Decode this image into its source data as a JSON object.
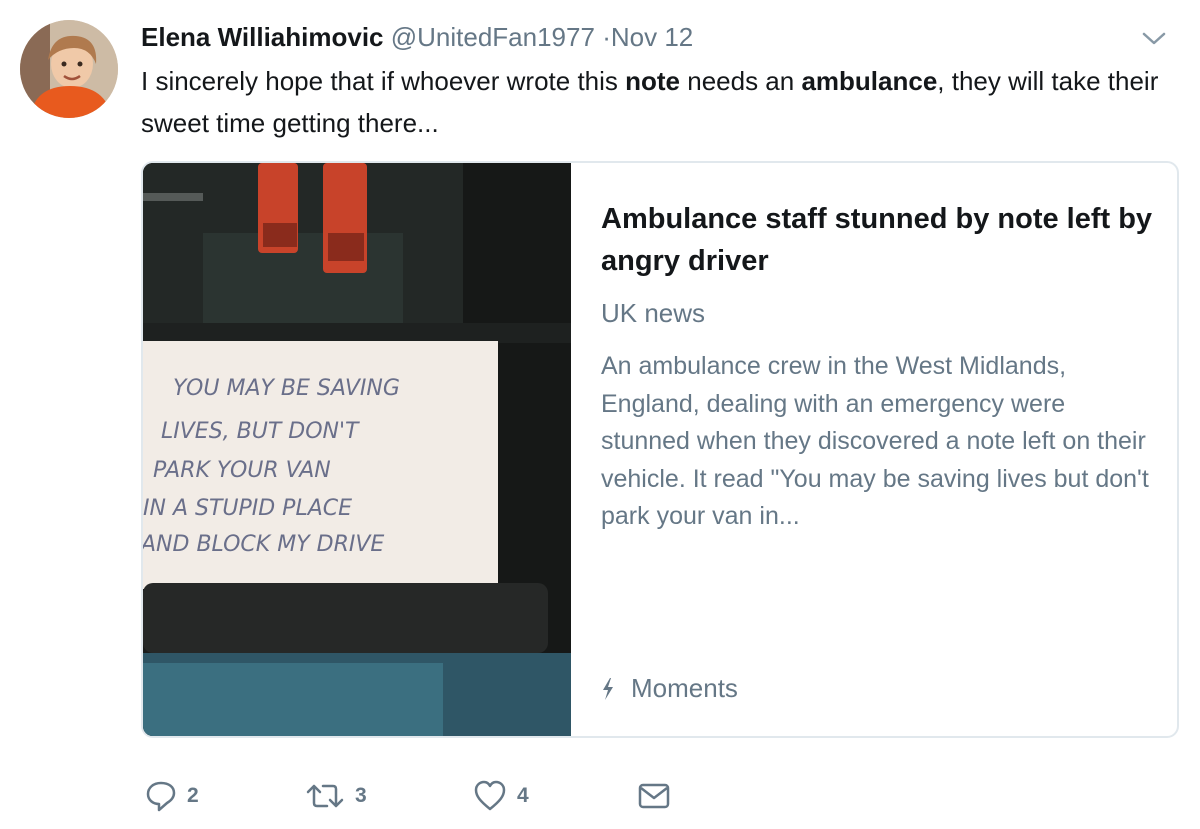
{
  "tweet": {
    "author_name": "Elena Williahimovic",
    "handle": "@UnitedFan1977",
    "separator": "·",
    "time": "Nov 12",
    "text_parts": {
      "p1": "I sincerely hope that if whoever wrote this ",
      "b1": "note",
      "p2": " needs an ",
      "b2": "ambulance",
      "p3": ", they will take their sweet time getting there..."
    }
  },
  "card": {
    "title": "Ambulance staff stunned by note left by angry driver",
    "source": "UK news",
    "description": "An ambulance crew in the West Midlands, England, dealing with an emergency were stunned when they discovered a note left on their vehicle. It read \"You may be saving lives but don't park your van in...",
    "footer_label": "Moments",
    "footer_icon": "lightning-icon",
    "note_lines": [
      "YOU MAY BE SAVING",
      "LIVES, BUT DON'T",
      "PARK YOUR VAN",
      "IN A STUPID PLACE",
      "AND BLOCK MY DRIVE"
    ]
  },
  "actions": {
    "reply_count": "2",
    "retweet_count": "3",
    "like_count": "4"
  },
  "colors": {
    "secondary_text": "#657786",
    "primary_text": "#14171a",
    "card_border": "#e1e8ed"
  }
}
